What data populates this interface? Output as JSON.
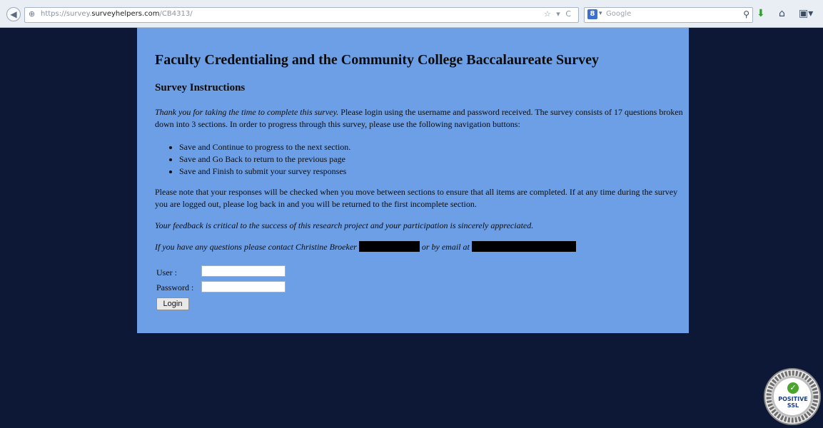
{
  "browser": {
    "url_prefix": "https://survey.",
    "url_host": "surveyhelpers.com",
    "url_path": "/CB4313/",
    "url_icons": "☆ ▾ C",
    "search_placeholder": "Google",
    "search_engine_letter": "8",
    "icons": [
      "back-icon",
      "site-identity-icon",
      "bookmark-star-icon",
      "reload-icon",
      "search-engine-icon",
      "search-icon",
      "download-icon",
      "home-icon",
      "menu-icon"
    ]
  },
  "page": {
    "title": "Faculty Credentialing and the Community College Baccalaureate Survey",
    "subtitle": "Survey Instructions",
    "intro_italic": "Thank you for taking the time to complete this survey.",
    "intro_rest": " Please login using the username and password received. The survey consists of 17 questions broken down into 3 sections. In order to progress through this survey, please use the following navigation buttons:",
    "bullets": [
      "Save and Continue to progress to the next section.",
      "Save and Go Back to return to the previous page",
      "Save and Finish to submit your survey responses"
    ],
    "note": "Please note that your responses will be checked when you move between sections to ensure that all items are completed. If at any time during the survey you are logged out, please log back in and you will be returned to the first incomplete section.",
    "feedback": "Your feedback is critical to the success of this research project and your participation is sincerely appreciated.",
    "contact_prefix": "If you have any questions please contact Christine Broeker",
    "contact_mid": "or by email at"
  },
  "login": {
    "user_label": "User :",
    "password_label": "Password :",
    "user_value": "",
    "password_value": "",
    "button_label": "Login"
  },
  "badge": {
    "label": "POSITIVE SSL",
    "ring_text": "DOMAIN SSL SECURED WEBSITE · SECURED BY COMODO"
  },
  "colors": {
    "page_background": "#0d1836",
    "panel_background": "#6d9fe6",
    "redaction": "#000000"
  }
}
